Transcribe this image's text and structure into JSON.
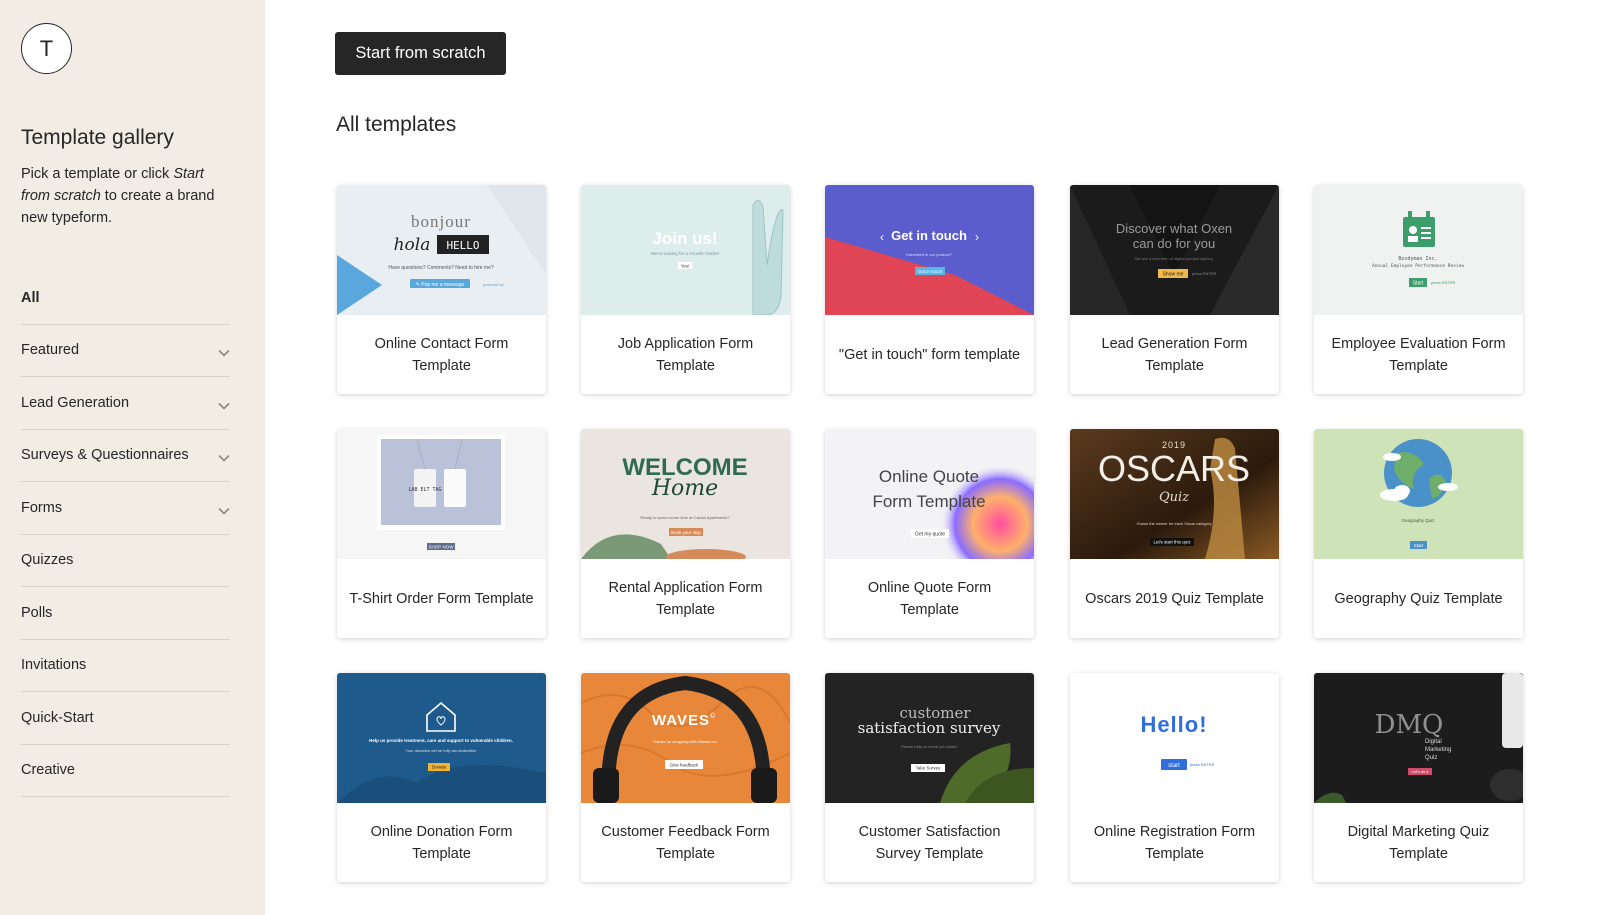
{
  "sidebar": {
    "logo_letter": "T",
    "title": "Template gallery",
    "desc_pre": "Pick a template or click ",
    "desc_em": "Start from scratch",
    "desc_post": " to create a brand new typeform.",
    "items": [
      {
        "label": "All",
        "has_chevron": false,
        "active": true
      },
      {
        "label": "Featured",
        "has_chevron": true
      },
      {
        "label": "Lead Generation",
        "has_chevron": true
      },
      {
        "label": "Surveys & Questionnaires",
        "has_chevron": true
      },
      {
        "label": "Forms",
        "has_chevron": true
      },
      {
        "label": "Quizzes",
        "has_chevron": false
      },
      {
        "label": "Polls",
        "has_chevron": false
      },
      {
        "label": "Invitations",
        "has_chevron": false
      },
      {
        "label": "Quick-Start",
        "has_chevron": false
      },
      {
        "label": "Creative",
        "has_chevron": false
      }
    ]
  },
  "main": {
    "start_button": "Start from scratch",
    "section_title": "All templates"
  },
  "templates": [
    {
      "label": "Online Contact Form Template",
      "thumb": {
        "l1": "bonjour",
        "l2": "hola",
        "l3": "HELLO",
        "sub": "Have questions? Comments? Need to hire me?",
        "btn": "✎ Pop me a message"
      }
    },
    {
      "label": "Job Application Form Template",
      "thumb": {
        "l1": "Join us!",
        "sub": "We're looking for a Growth Hacker",
        "btn": "Yes!"
      }
    },
    {
      "label": "\"Get in touch\" form template",
      "thumb": {
        "l1": "Get in touch",
        "btn": "Get in touch"
      }
    },
    {
      "label": "Lead Generation Form Template",
      "thumb": {
        "l1": "Discover what Oxen",
        "l2": "can do for you",
        "btn": "Show me"
      }
    },
    {
      "label": "Employee Evaluation Form Template",
      "thumb": {
        "l1": "Boxdyman Inc.",
        "l2": "Annual Employee Performance Review",
        "btn": "Start"
      }
    },
    {
      "label": "T-Shirt Order Form Template",
      "thumb": {
        "l1": "LAB ELT TAG",
        "btn": "SHOP NOW"
      }
    },
    {
      "label": "Rental Application Form Template",
      "thumb": {
        "l1": "WELCOME",
        "l2": "Home",
        "sub": "Ready to spend some time at Cactus Apartments?",
        "btn": "Book your stay"
      }
    },
    {
      "label": "Online Quote Form Template",
      "thumb": {
        "l1": "Online Quote",
        "l2": "Form Template",
        "btn": "Get my quote"
      }
    },
    {
      "label": "Oscars 2019 Quiz Template",
      "thumb": {
        "l0": "2019",
        "l1": "OSCARS",
        "l2": "Quiz",
        "btn": "Let's start this quiz"
      }
    },
    {
      "label": "Geography Quiz Template",
      "thumb": {
        "l1": "Geography Quiz",
        "btn": "Start"
      }
    },
    {
      "label": "Online Donation Form Template",
      "thumb": {
        "l1": "Help us provide treatment, care and support to vulnerable children.",
        "btn": "Donate"
      }
    },
    {
      "label": "Customer Feedback Form Template",
      "thumb": {
        "l1": "WAVES",
        "btn": "Give feedback"
      }
    },
    {
      "label": "Customer Satisfaction Survey Template",
      "thumb": {
        "l1": "customer",
        "l2": "satisfaction survey",
        "btn": "Take Survey"
      }
    },
    {
      "label": "Online Registration Form Template",
      "thumb": {
        "l1": "Hello!",
        "btn": "start"
      }
    },
    {
      "label": "Digital Marketing Quiz Template",
      "thumb": {
        "l0": "DMQ",
        "l1": "Digital",
        "l2": "Marketing",
        "l3": "Quiz",
        "btn": "Let's do it"
      }
    }
  ]
}
